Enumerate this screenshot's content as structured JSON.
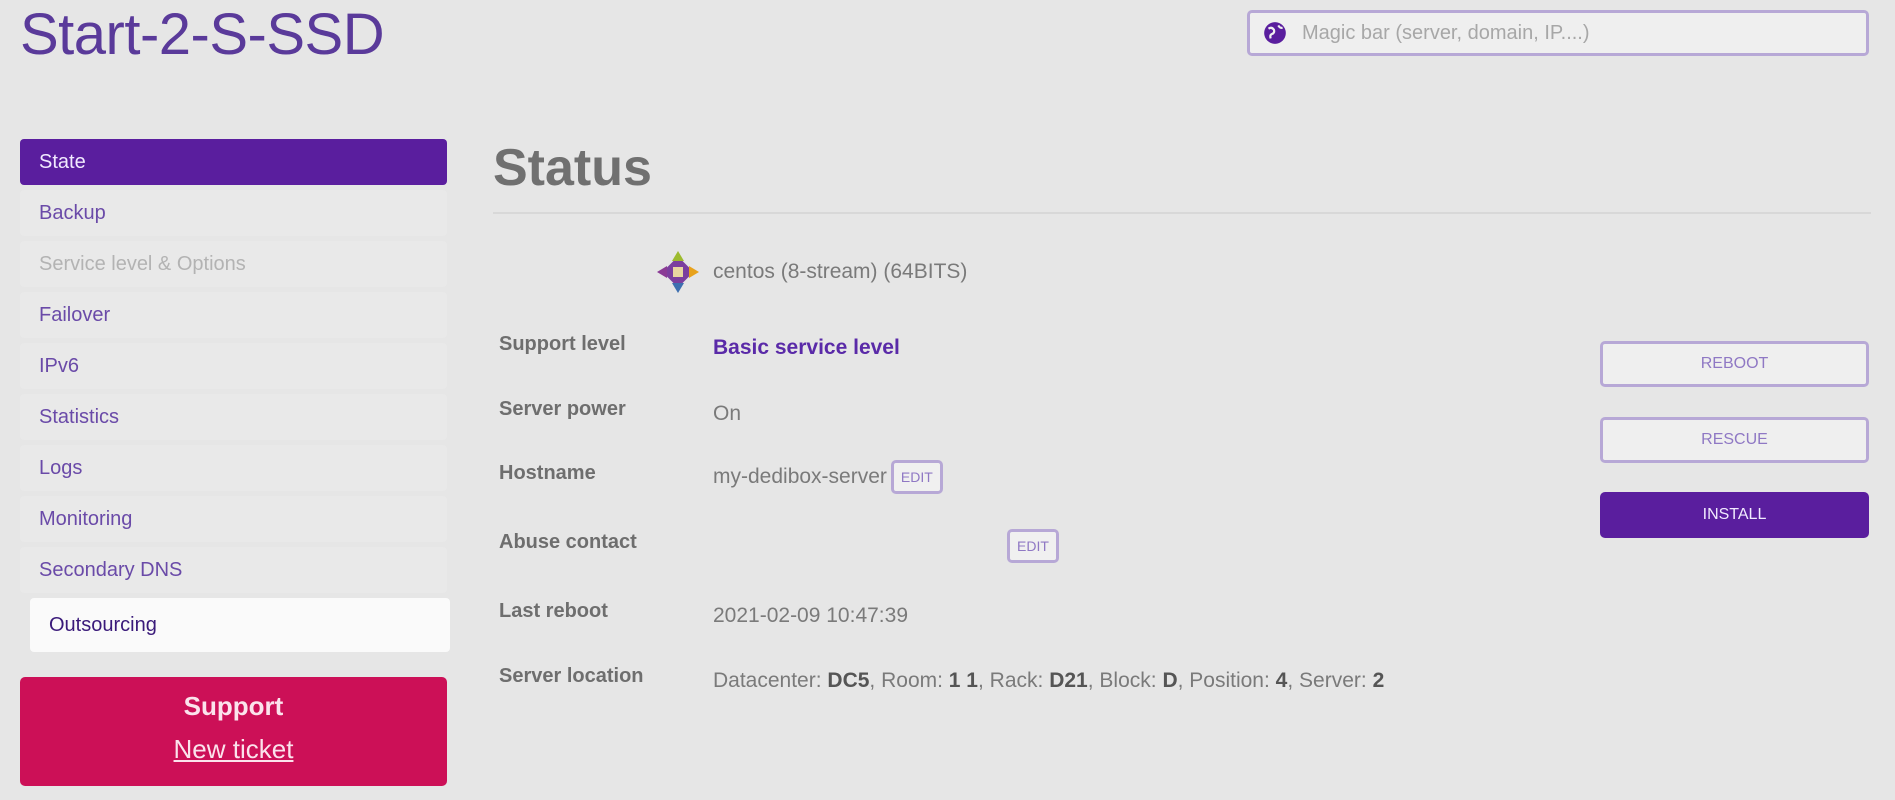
{
  "app": {
    "title": "Start-2-S-SSD"
  },
  "search": {
    "placeholder": "Magic bar (server, domain, IP....)"
  },
  "sidebar": {
    "items": [
      {
        "label": "State"
      },
      {
        "label": "Backup"
      },
      {
        "label": "Service level & Options"
      },
      {
        "label": "Failover"
      },
      {
        "label": "IPv6"
      },
      {
        "label": "Statistics"
      },
      {
        "label": "Logs"
      },
      {
        "label": "Monitoring"
      },
      {
        "label": "Secondary DNS"
      },
      {
        "label": "Outsourcing"
      }
    ]
  },
  "support": {
    "title": "Support",
    "link": "New ticket"
  },
  "main": {
    "title": "Status",
    "os": {
      "text": "centos (8-stream) (64BITS)"
    },
    "fields": {
      "support_level": {
        "label": "Support level",
        "value": "Basic service level"
      },
      "server_power": {
        "label": "Server power",
        "value": "On"
      },
      "hostname": {
        "label": "Hostname",
        "value": "my-dedibox-server",
        "edit": "EDIT"
      },
      "abuse_contact": {
        "label": "Abuse contact",
        "value": "",
        "edit": "EDIT"
      },
      "last_reboot": {
        "label": "Last reboot",
        "value": "2021-02-09 10:47:39"
      },
      "server_location": {
        "label": "Server location",
        "datacenter_label": "Datacenter:",
        "datacenter": "DC5",
        "room_label": "Room:",
        "room": "1 1",
        "rack_label": "Rack:",
        "rack": "D21",
        "block_label": "Block:",
        "block": "D",
        "position_label": "Position:",
        "position": "4",
        "server_label": "Server:",
        "server": "2"
      }
    },
    "actions": {
      "reboot": "REBOOT",
      "rescue": "RESCUE",
      "install": "INSTALL"
    }
  },
  "colors": {
    "accent": "#5a1e9e",
    "support": "#cc1057",
    "background": "#e6e6e6"
  }
}
